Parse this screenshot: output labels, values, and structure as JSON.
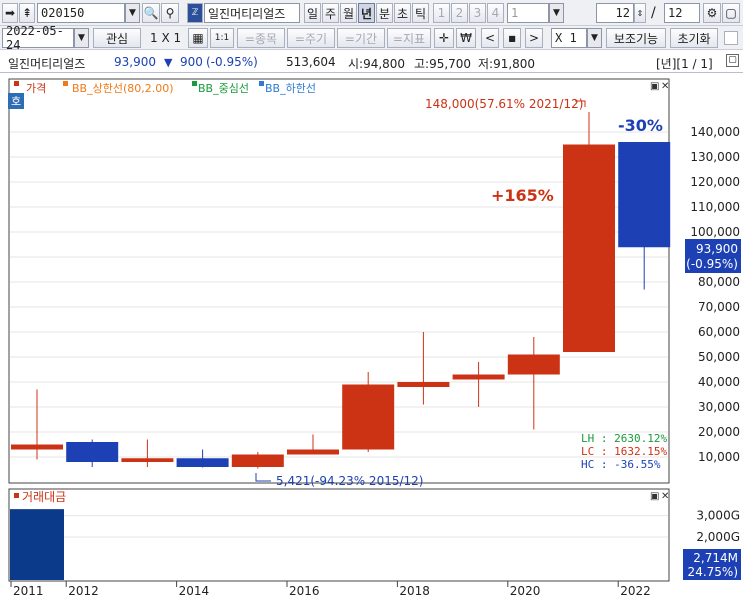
{
  "toolbar1": {
    "code": "020150",
    "name_icon": "stock-name-icon",
    "name": "일진머티리얼즈",
    "periods": [
      "일",
      "주",
      "월",
      "년",
      "분",
      "초",
      "틱"
    ],
    "active_period": "년",
    "numbers": [
      "1",
      "2",
      "3",
      "4"
    ],
    "count_value": "1",
    "page_current": "12",
    "page_sep": "/",
    "page_total": "12"
  },
  "toolbar2": {
    "date": "2022-05-24",
    "watch_label": "관심",
    "grid_label": "1 X 1",
    "one_label": "1:1",
    "item_label": "=종목",
    "period_label": "=주기",
    "range_label": "=기간",
    "indicator_label": "=지표",
    "multiplier": "X 1",
    "aux_label": "보조기능",
    "reset_label": "초기화"
  },
  "info": {
    "name": "일진머티리얼즈",
    "price": "93,900",
    "change_arrow": "▼",
    "change": "900",
    "change_pct": "(-0.95%)",
    "volume": "513,604",
    "open": "시:94,800",
    "high": "고:95,700",
    "low": "저:91,800",
    "period_page": "[년][1 / 1]"
  },
  "colors": {
    "up": "#cc3314",
    "down": "#1d41b5",
    "bb_upper": "#f07a1a",
    "bb_mid": "#199b3c",
    "bb_lower": "#2e7bd1",
    "volume": "#0b3a8a"
  },
  "chart_data": {
    "type": "candlestick",
    "title": "",
    "x_tick_labels": [
      "2011",
      "2012",
      "2014",
      "2016",
      "2018",
      "2020",
      "2022"
    ],
    "y_tick_labels": [
      "10,000",
      "20,000",
      "30,000",
      "40,000",
      "50,000",
      "60,000",
      "70,000",
      "80,000",
      "90,000",
      "100,000",
      "110,000",
      "120,000",
      "130,000",
      "140,000"
    ],
    "ylim": [
      0,
      150000
    ],
    "scale": "linear",
    "series": [
      {
        "name": "가격",
        "candles": [
          {
            "x": "2011",
            "open": 13000,
            "close": 15000,
            "high": 37000,
            "low": 9000
          },
          {
            "x": "2012",
            "open": 16000,
            "close": 8000,
            "high": 17000,
            "low": 6000
          },
          {
            "x": "2013",
            "open": 8000,
            "close": 9500,
            "high": 17000,
            "low": 6000
          },
          {
            "x": "2014",
            "open": 9500,
            "close": 6000,
            "high": 13000,
            "low": 5800
          },
          {
            "x": "2015",
            "open": 6000,
            "close": 11000,
            "high": 12000,
            "low": 5421
          },
          {
            "x": "2016",
            "open": 11000,
            "close": 13000,
            "high": 19000,
            "low": 11000
          },
          {
            "x": "2017",
            "open": 13000,
            "close": 39000,
            "high": 44000,
            "low": 12000
          },
          {
            "x": "2018",
            "open": 38000,
            "close": 40000,
            "high": 60000,
            "low": 31000
          },
          {
            "x": "2019",
            "open": 41000,
            "close": 43000,
            "high": 48000,
            "low": 30000
          },
          {
            "x": "2020",
            "open": 43000,
            "close": 51000,
            "high": 58000,
            "low": 21000
          },
          {
            "x": "2021",
            "open": 52000,
            "close": 135000,
            "high": 148000,
            "low": 52000
          },
          {
            "x": "2022",
            "open": 136000,
            "close": 93900,
            "high": 136000,
            "low": 77000
          }
        ]
      },
      {
        "name": "BB_상한선(80,2.00)"
      },
      {
        "name": "BB_중심선"
      },
      {
        "name": "BB_하한선"
      }
    ],
    "annotations": {
      "high_label": "148,000(57.61% 2021/12)",
      "low_label": "5,421(-94.23% 2015/12)",
      "gain_label": "+165%",
      "drop_label": "-30%",
      "price_box_value": "93,900",
      "price_box_pct": "(-0.95%)",
      "lh": "LH :  2630.12%",
      "lc": "LC :  1632.15%",
      "hc": "HC :   -36.55%",
      "left_badge": "호"
    },
    "volume_panel": {
      "name": "거래대금",
      "y_tick_labels": [
        "2,000G",
        "3,000G"
      ],
      "value_box": "2,714M",
      "value_box_pct": "( 24.75%)",
      "visible_bar": {
        "x": "2011",
        "value": 3300
      }
    }
  }
}
